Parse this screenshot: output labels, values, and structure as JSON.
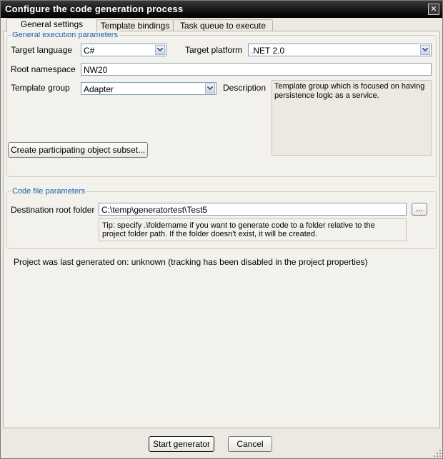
{
  "window": {
    "title": "Configure the code generation process"
  },
  "tabs": [
    {
      "label": "General settings",
      "active": true
    },
    {
      "label": "Template bindings",
      "active": false
    },
    {
      "label": "Task queue to execute",
      "active": false
    }
  ],
  "general": {
    "group_title": "General execution parameters",
    "target_language_label": "Target language",
    "target_language_value": "C#",
    "target_platform_label": "Target platform",
    "target_platform_value": ".NET 2.0",
    "root_namespace_label": "Root namespace",
    "root_namespace_value": "NW20",
    "template_group_label": "Template group",
    "template_group_value": "Adapter",
    "description_label": "Description",
    "description_text": "Template group which is focused on having persistence logic as a service.",
    "subset_button": "Create participating object subset..."
  },
  "code_file": {
    "group_title": "Code file parameters",
    "destination_label": "Destination root folder",
    "destination_value": "C:\\temp\\generatortest\\Test5",
    "browse_button": "...",
    "tip_line1": "Tip: specify .\\foldername if you want to generate code to a folder relative to the",
    "tip_line2": "project folder path. If the folder doesn't exist, it will be created."
  },
  "status_text": "Project was last generated on: unknown (tracking has been disabled in the project properties)",
  "footer": {
    "start_button": "Start generator",
    "cancel_button": "Cancel"
  },
  "colors": {
    "titlebar": "#161616",
    "group_title": "#1f5fae",
    "background": "#ece9e2"
  }
}
